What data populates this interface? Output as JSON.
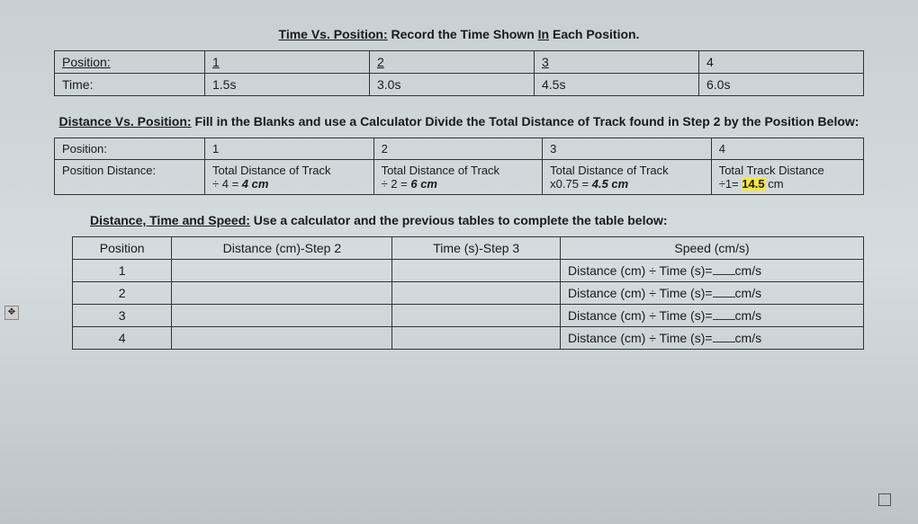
{
  "section1": {
    "title_prefix": "Time Vs. Position:",
    "title_rest": " Record the Time Shown ",
    "title_underline": "In",
    "title_end": " Each Position.",
    "row1_label": "Position:",
    "row2_label": "Time:",
    "positions": [
      "1",
      "2",
      "3",
      "4"
    ],
    "times": [
      "1.5s",
      "3.0s",
      "4.5s",
      "6.0s"
    ]
  },
  "section2": {
    "title_prefix": "Distance Vs. Position:",
    "title_rest": " Fill in the Blanks and use a Calculator Divide the Total Distance of Track found in Step 2 by the Position Below:",
    "row1_label": "Position:",
    "row2_label": "Position Distance:",
    "positions": [
      "1",
      "2",
      "3",
      "4"
    ],
    "cell1_line1": "Total Distance of Track",
    "cell1_line2a": "÷ 4 = ",
    "cell1_line2b": "4 cm",
    "cell2_line1": "Total Distance of Track",
    "cell2_line2a": "÷ 2 = ",
    "cell2_line2b": "6 cm",
    "cell3_line1": "Total Distance of Track",
    "cell3_line2a": "x0.75 = ",
    "cell3_line2b": "4.5 cm",
    "cell4_line1": "Total Track Distance",
    "cell4_line2a": "÷1= ",
    "cell4_line2b": "14.5",
    "cell4_line2c": " cm"
  },
  "section3": {
    "title_prefix": "Distance, Time and Speed:",
    "title_rest": " Use a calculator and the previous tables to complete the table below:",
    "headers": {
      "position": "Position",
      "distance": "Distance (cm)-Step 2",
      "time": "Time (s)-Step 3",
      "speed": "Speed (cm/s)"
    },
    "rows": [
      "1",
      "2",
      "3",
      "4"
    ],
    "formula": "Distance (cm) ÷ Time (s)=",
    "unit": "cm/s"
  }
}
